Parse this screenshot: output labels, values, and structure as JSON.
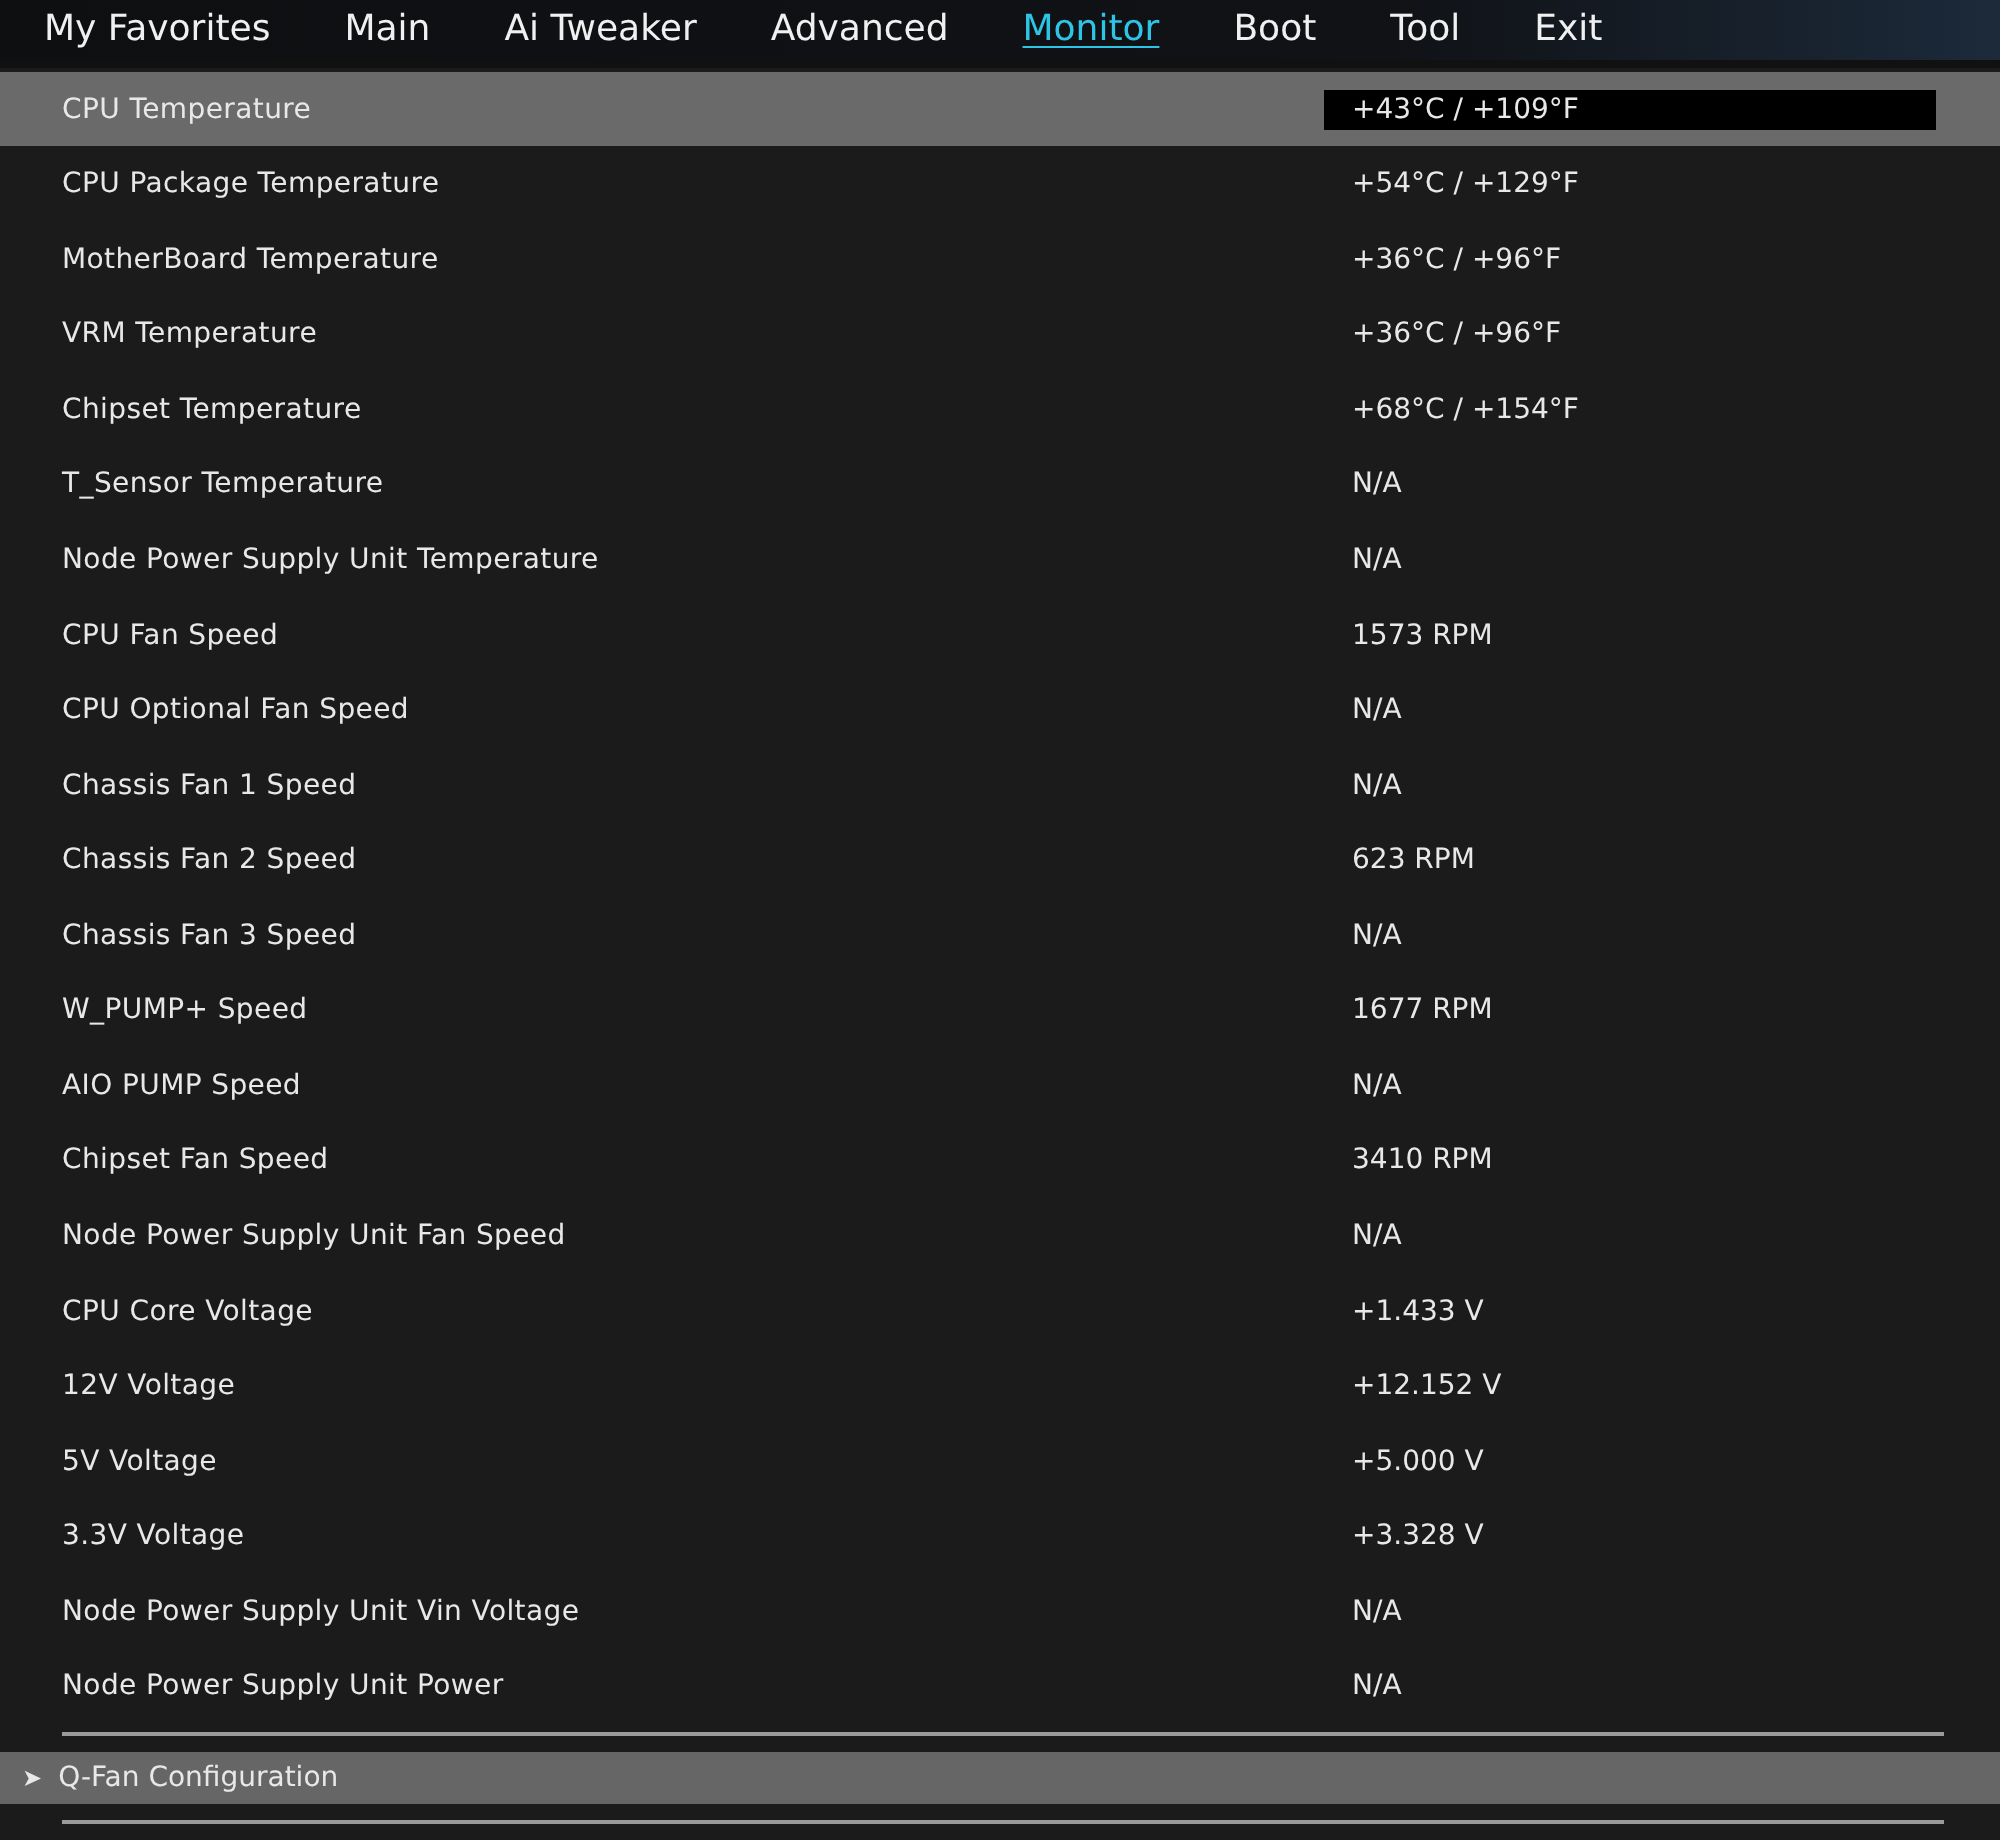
{
  "tabs": [
    {
      "label": "My Favorites",
      "selected": false
    },
    {
      "label": "Main",
      "selected": false
    },
    {
      "label": "Ai Tweaker",
      "selected": false
    },
    {
      "label": "Advanced",
      "selected": false
    },
    {
      "label": "Monitor",
      "selected": true
    },
    {
      "label": "Boot",
      "selected": false
    },
    {
      "label": "Tool",
      "selected": false
    },
    {
      "label": "Exit",
      "selected": false
    }
  ],
  "items": [
    {
      "label": "CPU Temperature",
      "value": "+43°C / +109°F",
      "selected": true
    },
    {
      "label": "CPU Package Temperature",
      "value": "+54°C / +129°F",
      "selected": false
    },
    {
      "label": "MotherBoard Temperature",
      "value": "+36°C / +96°F",
      "selected": false
    },
    {
      "label": "VRM Temperature",
      "value": "+36°C / +96°F",
      "selected": false
    },
    {
      "label": "Chipset Temperature",
      "value": "+68°C / +154°F",
      "selected": false
    },
    {
      "label": "T_Sensor Temperature",
      "value": "N/A",
      "selected": false
    },
    {
      "label": "Node Power Supply Unit Temperature",
      "value": "N/A",
      "selected": false
    },
    {
      "label": "CPU Fan Speed",
      "value": "1573 RPM",
      "selected": false
    },
    {
      "label": "CPU Optional Fan Speed",
      "value": "N/A",
      "selected": false
    },
    {
      "label": "Chassis Fan 1 Speed",
      "value": "N/A",
      "selected": false
    },
    {
      "label": "Chassis Fan 2 Speed",
      "value": "623 RPM",
      "selected": false
    },
    {
      "label": "Chassis Fan 3 Speed",
      "value": "N/A",
      "selected": false
    },
    {
      "label": "W_PUMP+ Speed",
      "value": "1677 RPM",
      "selected": false
    },
    {
      "label": "AIO PUMP Speed",
      "value": "N/A",
      "selected": false
    },
    {
      "label": "Chipset Fan Speed",
      "value": "3410 RPM",
      "selected": false
    },
    {
      "label": "Node Power Supply Unit Fan Speed",
      "value": "N/A",
      "selected": false
    },
    {
      "label": "CPU Core Voltage",
      "value": "+1.433 V",
      "selected": false
    },
    {
      "label": "12V Voltage",
      "value": "+12.152 V",
      "selected": false
    },
    {
      "label": "5V Voltage",
      "value": "+5.000 V",
      "selected": false
    },
    {
      "label": "3.3V Voltage",
      "value": "+3.328 V",
      "selected": false
    },
    {
      "label": "Node Power Supply Unit Vin Voltage",
      "value": "N/A",
      "selected": false
    },
    {
      "label": "Node Power Supply Unit Power",
      "value": "N/A",
      "selected": false
    }
  ],
  "submenus": [
    {
      "arrow": "➤",
      "label": "Q-Fan Configuration",
      "selected": true
    }
  ]
}
